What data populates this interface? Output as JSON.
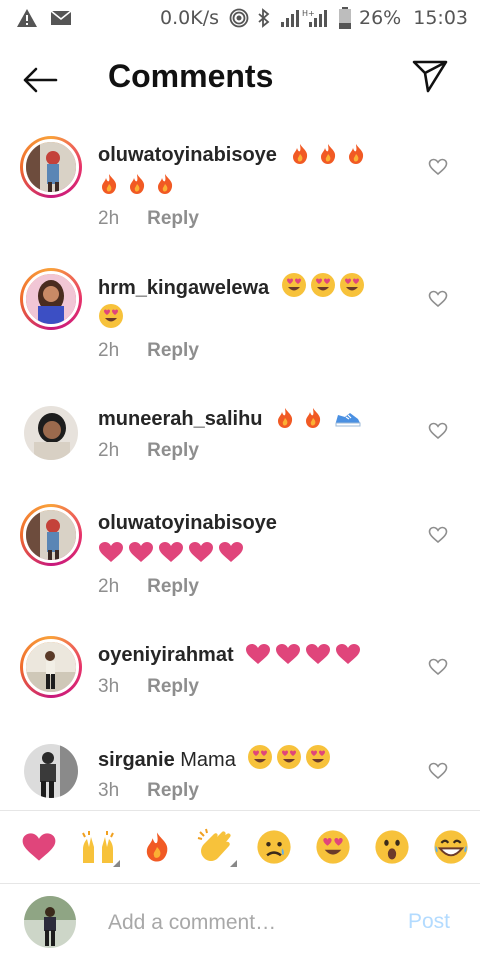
{
  "status_bar": {
    "speed": "0.0K/s",
    "battery": "26%",
    "time": "15:03",
    "icons": [
      "warning-icon",
      "mail-icon",
      "hotspot-icon",
      "bluetooth-icon",
      "signal-icon",
      "battery-icon"
    ]
  },
  "header": {
    "title": "Comments",
    "back_icon": "arrow-left-icon",
    "send_icon": "paper-plane-icon"
  },
  "comments": [
    {
      "username": "oluwatoyinabisoye",
      "text": "",
      "emojis": [
        "fire",
        "fire",
        "fire",
        "fire",
        "fire",
        "fire"
      ],
      "time": "2h",
      "reply": "Reply",
      "story_ring": true
    },
    {
      "username": "hrm_kingawelewa",
      "text": "",
      "emojis": [
        "heart-eyes",
        "heart-eyes",
        "heart-eyes",
        "heart-eyes"
      ],
      "time": "2h",
      "reply": "Reply",
      "story_ring": true
    },
    {
      "username": "muneerah_salihu",
      "text": "",
      "emojis": [
        "fire",
        "fire",
        "sneaker"
      ],
      "time": "2h",
      "reply": "Reply",
      "story_ring": false
    },
    {
      "username": "oluwatoyinabisoye",
      "text": "",
      "emojis": [
        "heart",
        "heart",
        "heart",
        "heart",
        "heart"
      ],
      "time": "2h",
      "reply": "Reply",
      "story_ring": true
    },
    {
      "username": "oyeniyirahmat",
      "text": "",
      "emojis": [
        "heart",
        "heart",
        "heart",
        "heart"
      ],
      "time": "3h",
      "reply": "Reply",
      "story_ring": true
    },
    {
      "username": "sirganie",
      "text": "Mama",
      "emojis": [
        "heart-eyes",
        "heart-eyes",
        "heart-eyes"
      ],
      "time": "3h",
      "reply": "Reply",
      "story_ring": false
    }
  ],
  "reactions": [
    "heart",
    "raised-hands",
    "fire",
    "clapping-hands",
    "sad-face",
    "heart-eyes",
    "surprised-face",
    "grinning-face"
  ],
  "composer": {
    "placeholder": "Add a comment…",
    "post_label": "Post"
  },
  "colors": {
    "text": "#262626",
    "muted": "#8e8e8e",
    "post_disabled": "#b3dbff",
    "heart": "#e0457b",
    "fire": "#f15a24",
    "emoji_yellow": "#f7c23b"
  }
}
